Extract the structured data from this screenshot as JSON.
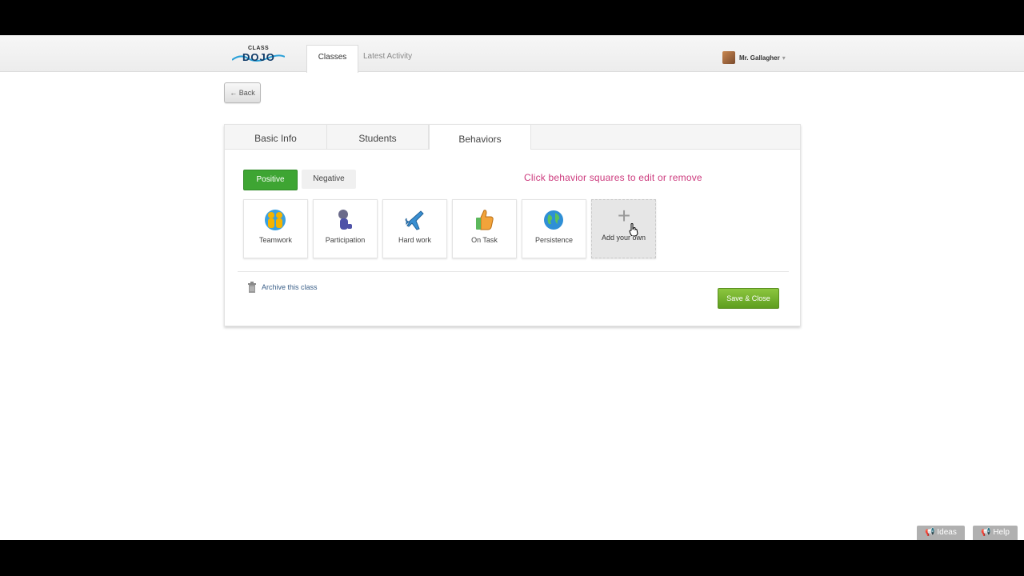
{
  "app": {
    "logo_small": "CLASS",
    "logo_big": "DOJO"
  },
  "nav": {
    "tabs": [
      {
        "label": "Classes"
      },
      {
        "label": "Latest Activity"
      }
    ]
  },
  "user": {
    "name": "Mr. Gallagher"
  },
  "back_label": "← Back",
  "panel": {
    "tabs": [
      {
        "label": "Basic Info"
      },
      {
        "label": "Students"
      },
      {
        "label": "Behaviors"
      }
    ],
    "toggle": {
      "positive": "Positive",
      "negative": "Negative"
    },
    "hint": "Click behavior squares to edit or remove",
    "behaviors": [
      {
        "label": "Teamwork",
        "icon": "teamwork-icon"
      },
      {
        "label": "Participation",
        "icon": "participation-icon"
      },
      {
        "label": "Hard work",
        "icon": "hard-work-icon"
      },
      {
        "label": "On Task",
        "icon": "on-task-icon"
      },
      {
        "label": "Persistence",
        "icon": "persistence-icon"
      }
    ],
    "add_label": "Add your own",
    "archive_label": "Archive this class",
    "save_label": "Save & Close"
  },
  "corner": {
    "ideas": "Ideas",
    "help": "Help"
  },
  "colors": {
    "positive": "#3ea533",
    "hint": "#cc3a7d",
    "save": "#6bb02a"
  }
}
